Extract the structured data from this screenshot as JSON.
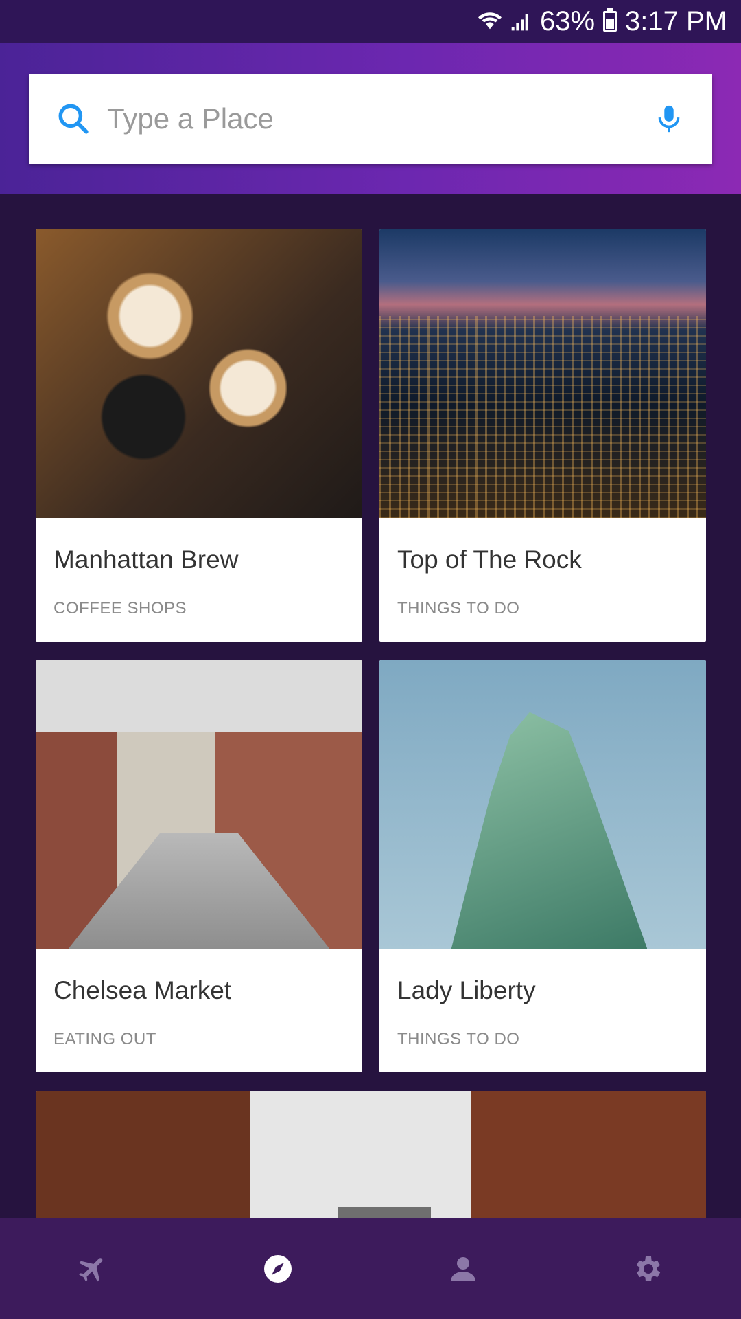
{
  "status_bar": {
    "battery_percent": "63%",
    "time": "3:17 PM",
    "icons": [
      "wifi-icon",
      "signal-icon",
      "battery-icon"
    ]
  },
  "search": {
    "placeholder": "Type a Place",
    "value": ""
  },
  "places": [
    {
      "title": "Manhattan Brew",
      "category": "COFFEE SHOPS"
    },
    {
      "title": "Top of The Rock",
      "category": "THINGS TO DO"
    },
    {
      "title": "Chelsea Market",
      "category": "EATING OUT"
    },
    {
      "title": "Lady Liberty",
      "category": "THINGS TO DO"
    }
  ],
  "bottom_nav": {
    "items": [
      "airplane-icon",
      "compass-icon",
      "person-icon",
      "gear-icon"
    ],
    "active": "compass-icon"
  },
  "colors": {
    "accent": "#2196f3",
    "header_start": "#4b2397",
    "header_end": "#8c29b4",
    "background": "#26133f",
    "nav_background": "#3d1b5c",
    "nav_inactive": "#8c77a8",
    "nav_active": "#ffffff"
  }
}
